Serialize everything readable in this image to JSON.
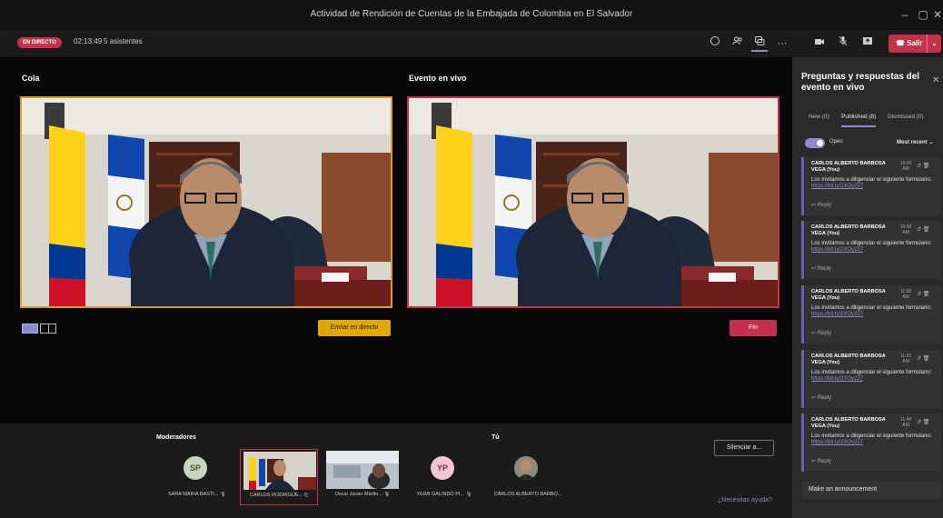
{
  "window": {
    "title": "Actividad de Rendición de Cuentas de la Embajada de Colombia en El Salvador",
    "controls": [
      "minimize",
      "restore",
      "close"
    ]
  },
  "toolbar": {
    "live_badge": "EN DIRECTO",
    "timer": "02:13:49",
    "attendees": "5 asistentes",
    "icons": [
      "chat-icon",
      "people-icon",
      "qa-icon",
      "more-icon",
      "camera-icon",
      "mic-off-icon",
      "share-icon"
    ],
    "leave_label": "Salir"
  },
  "stage": {
    "queue_label": "Cola",
    "live_label": "Evento en vivo",
    "go_live_button": "Enviar en directo",
    "end_button": "Fin"
  },
  "bottom": {
    "moderators_title": "Moderadores",
    "you_title": "Tú",
    "participants": [
      {
        "name": "SARA MARIA BASTI...",
        "initials": "SP"
      },
      {
        "name": "CARLOS RODRIGUE...",
        "initials": ""
      },
      {
        "name": "Oscar Javier Martin...",
        "initials": ""
      },
      {
        "name": "YEIMI GALINDO PI...",
        "initials": "YP"
      },
      {
        "name": "CARLOS ALBERTO BARBO...",
        "initials": ""
      }
    ],
    "mute_button": "Silenciar a...",
    "help_link": "¿Necesitas ayuda?"
  },
  "qa": {
    "title": "Preguntas y respuestas del evento en vivo",
    "tabs": [
      "New (0)",
      "Published (8)",
      "Dismissed (0)"
    ],
    "toggle_label": "Open",
    "sort_label": "Most recent",
    "cards": [
      {
        "author": "CARLOS ALBERTO BARBOSA VEGA (You)",
        "time": "10:49 AM",
        "msg": "Los invitamos a diligenciar el siguiente formulario:",
        "link": "https://bit.ly/2XOy227",
        "reply": "Reply"
      },
      {
        "author": "CARLOS ALBERTO BARBOSA VEGA (You)",
        "time": "10:58 AM",
        "msg": "Los invitamos a diligenciar el siguiente formulario:",
        "link": "https://bit.ly/2XOy227",
        "reply": "Reply"
      },
      {
        "author": "CARLOS ALBERTO BARBOSA VEGA (You)",
        "time": "11:08 AM",
        "msg": "Los invitamos a diligenciar el siguiente formulario:",
        "link": "https://bit.ly/2XOy227",
        "reply": "Reply"
      },
      {
        "author": "CARLOS ALBERTO BARBOSA VEGA (You)",
        "time": "11:22 AM",
        "msg": "Los invitamos a diligenciar el siguiente formulario:",
        "link": "https://bit.ly/2XOy227",
        "reply": "Reply"
      },
      {
        "author": "CARLOS ALBERTO BARBOSA VEGA (You)",
        "time": "11:44 AM",
        "msg": "Los invitamos a diligenciar el siguiente formulario:",
        "link": "https://bit.ly/2XOy227",
        "reply": "Reply"
      }
    ],
    "announcement": "Make an announcement"
  }
}
